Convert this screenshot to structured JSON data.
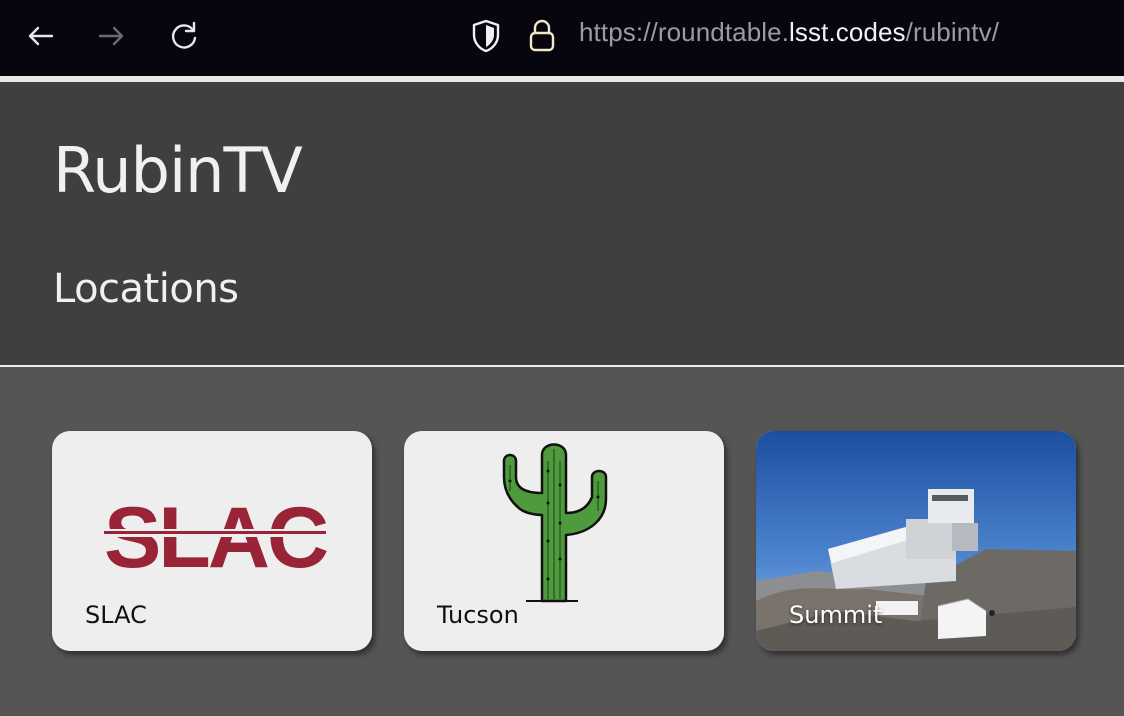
{
  "browser": {
    "url_prefix": "https://roundtable.",
    "url_host": "lsst.codes",
    "url_path": "/rubintv/"
  },
  "page": {
    "site_title": "RubinTV",
    "section_title": "Locations"
  },
  "locations": [
    {
      "label": "SLAC",
      "logo_text": "SLAC",
      "logo_color": "#9a2437"
    },
    {
      "label": "Tucson",
      "image": "saguaro-cactus"
    },
    {
      "label": "Summit",
      "image": "observatory-photo"
    }
  ],
  "colors": {
    "browser_bar": "#07060f",
    "header_bg": "#3f3f3f",
    "body_bg": "#555555",
    "card_bg": "#eeeeee",
    "slac_red": "#9a2437",
    "cactus_green": "#4f9a3c"
  }
}
